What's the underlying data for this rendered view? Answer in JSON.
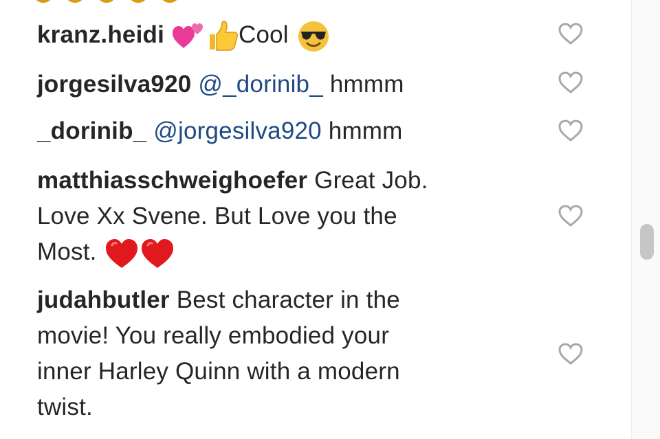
{
  "comments": [
    {
      "username": "kranz.heidi",
      "text": "Cool",
      "emojis": [
        "two-hearts-icon",
        "thumbs-up-icon",
        "sunglasses-face-icon"
      ]
    },
    {
      "username": "jorgesilva920",
      "mention": "@_dorinib_",
      "text": "hmmm"
    },
    {
      "username": "_dorinib_",
      "mention": "@jorgesilva920",
      "text": "hmmm"
    },
    {
      "username": "matthiasschweighoefer",
      "text_line1": "Great Job.",
      "text_line2": "Love Xx Svene. But Love you the",
      "text_line3": "Most.",
      "emojis": [
        "red-heart-icon",
        "red-heart-icon"
      ]
    },
    {
      "username": "judahbutler",
      "text_line1": "Best character in the",
      "text_line2": "movie! You really embodied your",
      "text_line3": "inner Harley Quinn with a modern",
      "text_line4": "twist."
    }
  ],
  "icons": {
    "like": "heart-outline-icon"
  },
  "colors": {
    "username": "#262626",
    "mention": "#1f4a85",
    "heart_outline": "#a8a8a8",
    "emoji_heart": "#e0191f",
    "emoji_yellow": "#f5c33b"
  }
}
